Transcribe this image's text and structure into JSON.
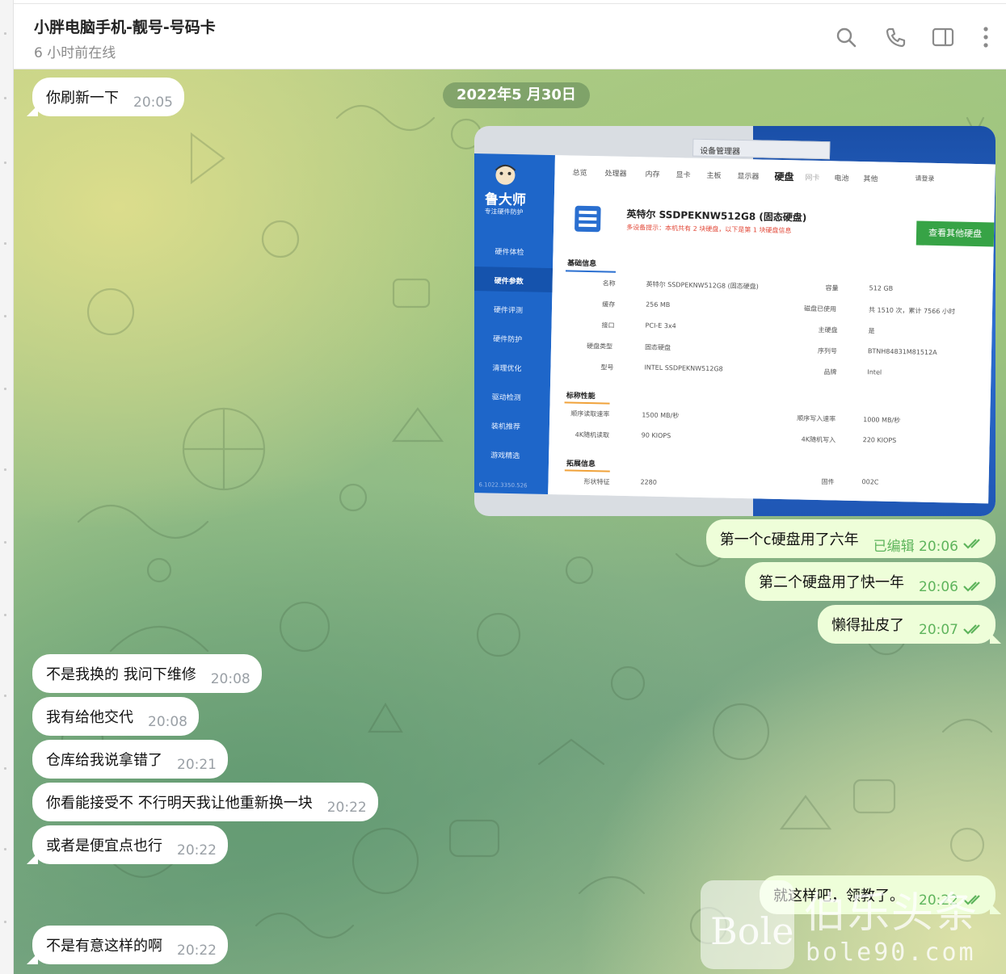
{
  "header": {
    "title": "小胖电脑手机-靓号-号码卡",
    "status": "6 小时前在线"
  },
  "date_divider": "2022年5 月30日",
  "messages_in": [
    {
      "text": "你刷新一下",
      "time": "20:05"
    },
    {
      "text": "不是我换的  我问下维修",
      "time": "20:08"
    },
    {
      "text": "我有给他交代",
      "time": "20:08"
    },
    {
      "text": "仓库给我说拿错了",
      "time": "20:21"
    },
    {
      "text": "你看能接受不  不行明天我让他重新换一块",
      "time": "20:22"
    },
    {
      "text": "或者是便宜点也行",
      "time": "20:22"
    },
    {
      "text": "不是有意这样的啊",
      "time": "20:22"
    }
  ],
  "messages_out": [
    {
      "text": "第一个c硬盘用了六年",
      "time": "已编辑 20:06"
    },
    {
      "text": "第二个硬盘用了快一年",
      "time": "20:06"
    },
    {
      "text": "懒得扯皮了",
      "time": "20:07"
    },
    {
      "text": "就这样吧，领教了。",
      "time": "20:22"
    }
  ],
  "photo": {
    "window_title": "设备管理器",
    "brand": "鲁大师",
    "brand_sub": "专注硬件防护",
    "sidebar": [
      "硬件体检",
      "硬件参数",
      "硬件评测",
      "硬件防护",
      "清理优化",
      "驱动检测",
      "装机推荐",
      "游戏精选"
    ],
    "version": "6.1022.3350.526",
    "tabs": [
      "总览",
      "处理器",
      "内存",
      "显卡",
      "主板",
      "显示器",
      "硬盘",
      "网卡",
      "电池",
      "其他"
    ],
    "login": "请登录",
    "disk_title": "英特尔 SSDPEKNW512G8 (固态硬盘)",
    "disk_hint": "多设备提示：本机共有 2 块硬盘，以下是第 1 块硬盘信息",
    "other_disk_button": "查看其他硬盘",
    "section_basic": "基础信息",
    "basic_left": [
      {
        "k": "名称",
        "v": "英特尔 SSDPEKNW512G8 (固态硬盘)"
      },
      {
        "k": "缓存",
        "v": "256 MB"
      },
      {
        "k": "接口",
        "v": "PCI-E 3x4"
      },
      {
        "k": "硬盘类型",
        "v": "固态硬盘"
      },
      {
        "k": "型号",
        "v": "INTEL SSDPEKNW512G8"
      }
    ],
    "basic_right": [
      {
        "k": "容量",
        "v": "512 GB"
      },
      {
        "k": "磁盘已使用",
        "v": "共 1510 次，累计 7566 小时"
      },
      {
        "k": "主硬盘",
        "v": "是"
      },
      {
        "k": "序列号",
        "v": "BTNH84831M81512A"
      },
      {
        "k": "品牌",
        "v": "Intel"
      }
    ],
    "section_perf": "标称性能",
    "perf": [
      {
        "k": "顺序读取速率",
        "v": "1500 MB/秒",
        "k2": "顺序写入速率",
        "v2": "1000 MB/秒"
      },
      {
        "k": "4K随机读取",
        "v": "90 KIOPS",
        "k2": "4K随机写入",
        "v2": "220 KIOPS"
      }
    ],
    "section_ext": "拓展信息",
    "ext": {
      "k": "形状特征",
      "v": "2280",
      "k2": "固件",
      "v2": "002C"
    }
  },
  "watermark": {
    "logo": "Bole",
    "cn": "伯乐头条",
    "url": "bole90.com"
  }
}
